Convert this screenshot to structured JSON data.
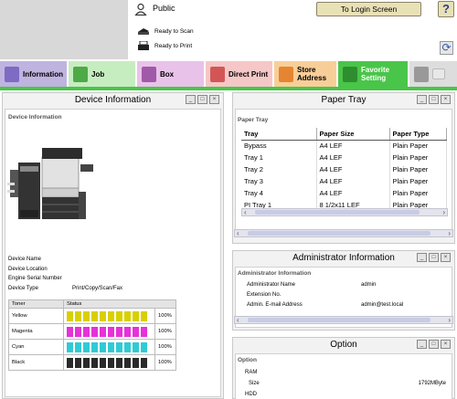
{
  "header": {
    "user": "Public",
    "login_button": "To Login Screen",
    "help": "?",
    "status_scan": "Ready to Scan",
    "status_print": "Ready to Print"
  },
  "tabs": [
    {
      "label": "Information",
      "bg": "#bfb3e0",
      "icon_color": "#7d6bc4"
    },
    {
      "label": "Job",
      "bg": "#c6edc0",
      "icon_color": "#4daa45"
    },
    {
      "label": "Box",
      "bg": "#e9c2e9",
      "icon_color": "#a05aa8"
    },
    {
      "label": "Direct Print",
      "bg": "#f5c7c7",
      "icon_color": "#d35656"
    },
    {
      "label": "Store Address",
      "bg": "#f8ce98",
      "icon_color": "#e58531"
    },
    {
      "label": "Favorite Setting",
      "bg": "#49c549",
      "icon_color": "#2e8d2e"
    },
    {
      "label": "",
      "bg": "#dddddd",
      "icon_color": "#999999"
    }
  ],
  "device_info": {
    "panel_title": "Device Information",
    "section_title": "Device Information",
    "fields": [
      {
        "label": "Device Name",
        "value": ""
      },
      {
        "label": "Device Location",
        "value": ""
      },
      {
        "label": "Engine Serial Number",
        "value": ""
      },
      {
        "label": "Device Type",
        "value": "Print/Copy/Scan/Fax"
      }
    ],
    "toner_header": [
      "Toner",
      "Status"
    ],
    "toners": [
      {
        "name": "Yellow",
        "level": "100%",
        "color": "#d8d000"
      },
      {
        "name": "Magenta",
        "level": "100%",
        "color": "#e632d8"
      },
      {
        "name": "Cyan",
        "level": "100%",
        "color": "#2ecbd6"
      },
      {
        "name": "Black",
        "level": "100%",
        "color": "#2a2a2a"
      }
    ]
  },
  "paper_tray": {
    "panel_title": "Paper Tray",
    "section_title": "Paper Tray",
    "columns": [
      "Tray",
      "Paper Size",
      "Paper Type"
    ],
    "rows": [
      [
        "Bypass",
        "A4 LEF",
        "Plain Paper"
      ],
      [
        "Tray 1",
        "A4 LEF",
        "Plain Paper"
      ],
      [
        "Tray 2",
        "A4 LEF",
        "Plain Paper"
      ],
      [
        "Tray 3",
        "A4 LEF",
        "Plain Paper"
      ],
      [
        "Tray 4",
        "A4 LEF",
        "Plain Paper"
      ],
      [
        "PI Tray 1",
        "8 1/2x11 LEF",
        "Plain Paper"
      ]
    ]
  },
  "admin": {
    "panel_title": "Administrator Information",
    "section_title": "Administrator Information",
    "fields": [
      {
        "label": "Administrator Name",
        "value": "admin"
      },
      {
        "label": "Extension No.",
        "value": ""
      },
      {
        "label": "Admin. E-mail Address",
        "value": "admin@test.local"
      }
    ]
  },
  "option": {
    "panel_title": "Option",
    "section_title": "Option",
    "ram": "RAM",
    "size_label": "Size",
    "size_value": "1792MByte",
    "hdd": "HDD"
  },
  "window_buttons": [
    "_",
    "□",
    "×"
  ]
}
